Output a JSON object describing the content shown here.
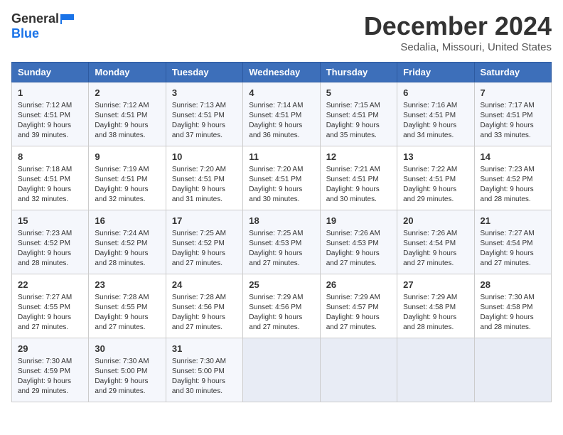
{
  "header": {
    "logo_general": "General",
    "logo_blue": "Blue",
    "title": "December 2024",
    "location": "Sedalia, Missouri, United States"
  },
  "days_of_week": [
    "Sunday",
    "Monday",
    "Tuesday",
    "Wednesday",
    "Thursday",
    "Friday",
    "Saturday"
  ],
  "weeks": [
    [
      {
        "day": "1",
        "sunrise": "7:12 AM",
        "sunset": "4:51 PM",
        "daylight": "9 hours and 39 minutes."
      },
      {
        "day": "2",
        "sunrise": "7:12 AM",
        "sunset": "4:51 PM",
        "daylight": "9 hours and 38 minutes."
      },
      {
        "day": "3",
        "sunrise": "7:13 AM",
        "sunset": "4:51 PM",
        "daylight": "9 hours and 37 minutes."
      },
      {
        "day": "4",
        "sunrise": "7:14 AM",
        "sunset": "4:51 PM",
        "daylight": "9 hours and 36 minutes."
      },
      {
        "day": "5",
        "sunrise": "7:15 AM",
        "sunset": "4:51 PM",
        "daylight": "9 hours and 35 minutes."
      },
      {
        "day": "6",
        "sunrise": "7:16 AM",
        "sunset": "4:51 PM",
        "daylight": "9 hours and 34 minutes."
      },
      {
        "day": "7",
        "sunrise": "7:17 AM",
        "sunset": "4:51 PM",
        "daylight": "9 hours and 33 minutes."
      }
    ],
    [
      {
        "day": "8",
        "sunrise": "7:18 AM",
        "sunset": "4:51 PM",
        "daylight": "9 hours and 32 minutes."
      },
      {
        "day": "9",
        "sunrise": "7:19 AM",
        "sunset": "4:51 PM",
        "daylight": "9 hours and 32 minutes."
      },
      {
        "day": "10",
        "sunrise": "7:20 AM",
        "sunset": "4:51 PM",
        "daylight": "9 hours and 31 minutes."
      },
      {
        "day": "11",
        "sunrise": "7:20 AM",
        "sunset": "4:51 PM",
        "daylight": "9 hours and 30 minutes."
      },
      {
        "day": "12",
        "sunrise": "7:21 AM",
        "sunset": "4:51 PM",
        "daylight": "9 hours and 30 minutes."
      },
      {
        "day": "13",
        "sunrise": "7:22 AM",
        "sunset": "4:51 PM",
        "daylight": "9 hours and 29 minutes."
      },
      {
        "day": "14",
        "sunrise": "7:23 AM",
        "sunset": "4:52 PM",
        "daylight": "9 hours and 28 minutes."
      }
    ],
    [
      {
        "day": "15",
        "sunrise": "7:23 AM",
        "sunset": "4:52 PM",
        "daylight": "9 hours and 28 minutes."
      },
      {
        "day": "16",
        "sunrise": "7:24 AM",
        "sunset": "4:52 PM",
        "daylight": "9 hours and 28 minutes."
      },
      {
        "day": "17",
        "sunrise": "7:25 AM",
        "sunset": "4:52 PM",
        "daylight": "9 hours and 27 minutes."
      },
      {
        "day": "18",
        "sunrise": "7:25 AM",
        "sunset": "4:53 PM",
        "daylight": "9 hours and 27 minutes."
      },
      {
        "day": "19",
        "sunrise": "7:26 AM",
        "sunset": "4:53 PM",
        "daylight": "9 hours and 27 minutes."
      },
      {
        "day": "20",
        "sunrise": "7:26 AM",
        "sunset": "4:54 PM",
        "daylight": "9 hours and 27 minutes."
      },
      {
        "day": "21",
        "sunrise": "7:27 AM",
        "sunset": "4:54 PM",
        "daylight": "9 hours and 27 minutes."
      }
    ],
    [
      {
        "day": "22",
        "sunrise": "7:27 AM",
        "sunset": "4:55 PM",
        "daylight": "9 hours and 27 minutes."
      },
      {
        "day": "23",
        "sunrise": "7:28 AM",
        "sunset": "4:55 PM",
        "daylight": "9 hours and 27 minutes."
      },
      {
        "day": "24",
        "sunrise": "7:28 AM",
        "sunset": "4:56 PM",
        "daylight": "9 hours and 27 minutes."
      },
      {
        "day": "25",
        "sunrise": "7:29 AM",
        "sunset": "4:56 PM",
        "daylight": "9 hours and 27 minutes."
      },
      {
        "day": "26",
        "sunrise": "7:29 AM",
        "sunset": "4:57 PM",
        "daylight": "9 hours and 27 minutes."
      },
      {
        "day": "27",
        "sunrise": "7:29 AM",
        "sunset": "4:58 PM",
        "daylight": "9 hours and 28 minutes."
      },
      {
        "day": "28",
        "sunrise": "7:30 AM",
        "sunset": "4:58 PM",
        "daylight": "9 hours and 28 minutes."
      }
    ],
    [
      {
        "day": "29",
        "sunrise": "7:30 AM",
        "sunset": "4:59 PM",
        "daylight": "9 hours and 29 minutes."
      },
      {
        "day": "30",
        "sunrise": "7:30 AM",
        "sunset": "5:00 PM",
        "daylight": "9 hours and 29 minutes."
      },
      {
        "day": "31",
        "sunrise": "7:30 AM",
        "sunset": "5:00 PM",
        "daylight": "9 hours and 30 minutes."
      },
      null,
      null,
      null,
      null
    ]
  ]
}
